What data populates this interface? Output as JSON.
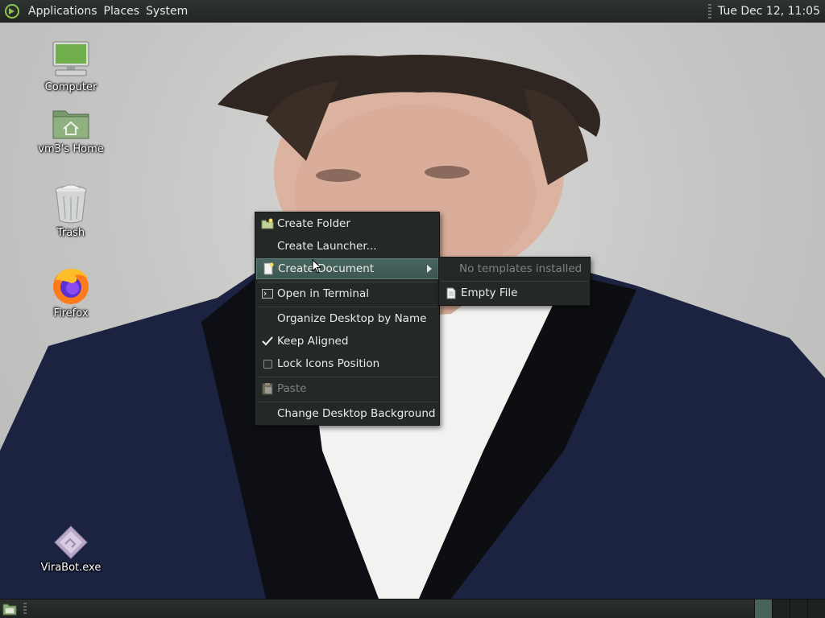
{
  "top_panel": {
    "menus": [
      "Applications",
      "Places",
      "System"
    ],
    "clock": "Tue Dec 12, 11:05"
  },
  "desktop_icons": [
    {
      "label": "Computer",
      "icon": "computer-icon"
    },
    {
      "label": "vm3's Home",
      "icon": "home-folder-icon"
    },
    {
      "label": "Trash",
      "icon": "trash-icon"
    },
    {
      "label": "Firefox",
      "icon": "firefox-icon"
    },
    {
      "label": "ViraBot.exe",
      "icon": "exe-file-icon"
    }
  ],
  "context_menu": {
    "items": [
      {
        "label": "Create Folder",
        "icon": "new-folder-icon"
      },
      {
        "label": "Create Launcher...",
        "icon": ""
      },
      {
        "label": "Create Document",
        "icon": "new-document-icon",
        "submenu": true,
        "highlighted": true
      },
      {
        "label": "Open in Terminal",
        "icon": "terminal-icon"
      },
      {
        "label": "Organize Desktop by Name",
        "icon": ""
      },
      {
        "label": "Keep Aligned",
        "icon": "checkmark-icon",
        "checked": true
      },
      {
        "label": "Lock Icons Position",
        "icon": "checkbox-icon",
        "checked": false
      },
      {
        "label": "Paste",
        "icon": "paste-icon",
        "disabled": true
      },
      {
        "label": "Change Desktop Background",
        "icon": ""
      }
    ]
  },
  "submenu": {
    "items": [
      {
        "label": "No templates installed",
        "disabled": true
      },
      {
        "label": "Empty File",
        "icon": "file-icon"
      }
    ]
  },
  "colors": {
    "panel": "#262b29",
    "menu_bg": "#242927",
    "highlight": "#45615b",
    "accent_green": "#8fc34a"
  }
}
